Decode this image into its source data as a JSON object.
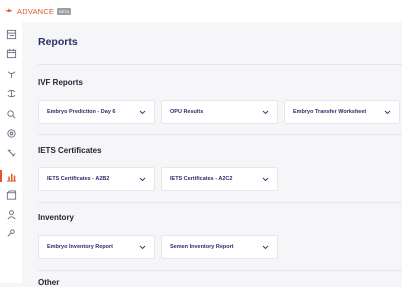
{
  "brand": {
    "name": "ADVANCE",
    "badge": "BETA"
  },
  "sidebar": {
    "items": [
      {
        "name": "dashboard-icon",
        "active": false
      },
      {
        "name": "calendar-icon",
        "active": false
      },
      {
        "name": "animals-icon",
        "active": false
      },
      {
        "name": "transfer-icon",
        "active": false
      },
      {
        "name": "search-icon",
        "active": false
      },
      {
        "name": "lab-icon",
        "active": false
      },
      {
        "name": "syringe-icon",
        "active": false
      },
      {
        "name": "reports-icon",
        "active": true
      },
      {
        "name": "inventory-icon",
        "active": false
      },
      {
        "name": "user-icon",
        "active": false
      },
      {
        "name": "settings-icon",
        "active": false
      }
    ],
    "accent": "#e0562a"
  },
  "page": {
    "title": "Reports"
  },
  "sections": {
    "ivf": {
      "title": "IVF Reports",
      "selects": [
        {
          "label": "Embryo Prediction - Day 6"
        },
        {
          "label": "OPU Results"
        },
        {
          "label": "Embryo Transfer Worksheet"
        }
      ]
    },
    "iets": {
      "title": "IETS Certificates",
      "selects": [
        {
          "label": "IETS Certificates - A2B2"
        },
        {
          "label": "IETS Certificates - A2C2"
        }
      ]
    },
    "inventory": {
      "title": "Inventory",
      "selects": [
        {
          "label": "Embryo Inventory Report"
        },
        {
          "label": "Semen Inventory Report"
        }
      ]
    },
    "other": {
      "title": "Other"
    }
  }
}
